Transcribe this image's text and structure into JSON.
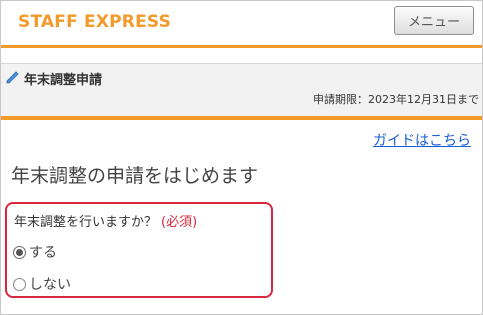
{
  "header": {
    "brand": "STAFF EXPRESS",
    "menu_label": "メニュー"
  },
  "subheader": {
    "icon": "pencil-icon",
    "title": "年末調整申請",
    "deadline": "申請期限：2023年12月31日まで"
  },
  "main": {
    "guide_link": "ガイドはこちら",
    "headline": "年末調整の申請をはじめます",
    "question": {
      "label": "年末調整を行いますか？",
      "required_label": "(必須)",
      "options": [
        {
          "label": "する",
          "selected": true
        },
        {
          "label": "しない",
          "selected": false
        }
      ]
    }
  },
  "colors": {
    "accent": "#f39a2b",
    "required": "#d8283d",
    "link": "#1a5fd6"
  }
}
